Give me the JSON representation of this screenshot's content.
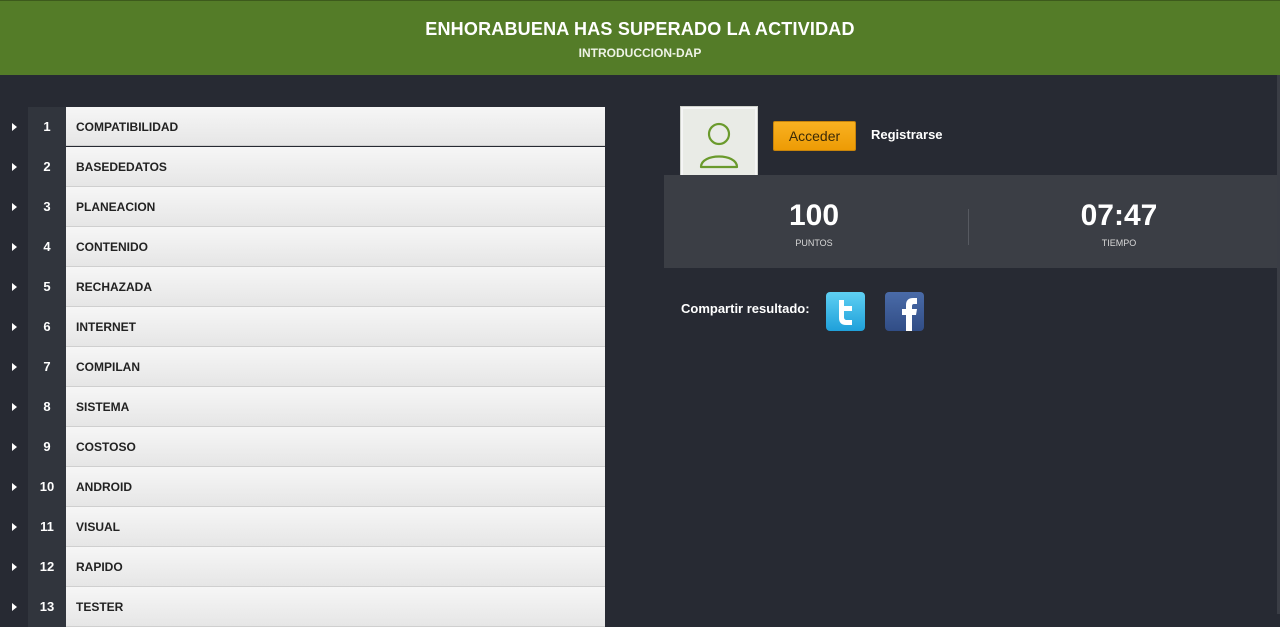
{
  "header": {
    "title": "ENHORABUENA HAS SUPERADO LA ACTIVIDAD",
    "subtitle": "INTRODUCCION-DAP",
    "color": "#547c28"
  },
  "words": [
    {
      "num": "1",
      "word": "COMPATIBILIDAD"
    },
    {
      "num": "2",
      "word": "BASEDEDATOS"
    },
    {
      "num": "3",
      "word": "PLANEACION"
    },
    {
      "num": "4",
      "word": "CONTENIDO"
    },
    {
      "num": "5",
      "word": "RECHAZADA"
    },
    {
      "num": "6",
      "word": "INTERNET"
    },
    {
      "num": "7",
      "word": "COMPILAN"
    },
    {
      "num": "8",
      "word": "SISTEMA"
    },
    {
      "num": "9",
      "word": "COSTOSO"
    },
    {
      "num": "10",
      "word": "ANDROID"
    },
    {
      "num": "11",
      "word": "VISUAL"
    },
    {
      "num": "12",
      "word": "RAPIDO"
    },
    {
      "num": "13",
      "word": "TESTER"
    }
  ],
  "user": {
    "avatar_icon": "user-icon",
    "login_label": "Acceder",
    "register_label": "Registrarse",
    "accent": "#f4a515"
  },
  "stats": {
    "points_value": "100",
    "points_label": "PUNTOS",
    "time_value": "07:47",
    "time_label": "TIEMPO"
  },
  "share": {
    "label": "Compartir resultado:",
    "twitter_icon": "twitter-icon",
    "facebook_icon": "facebook-icon"
  }
}
